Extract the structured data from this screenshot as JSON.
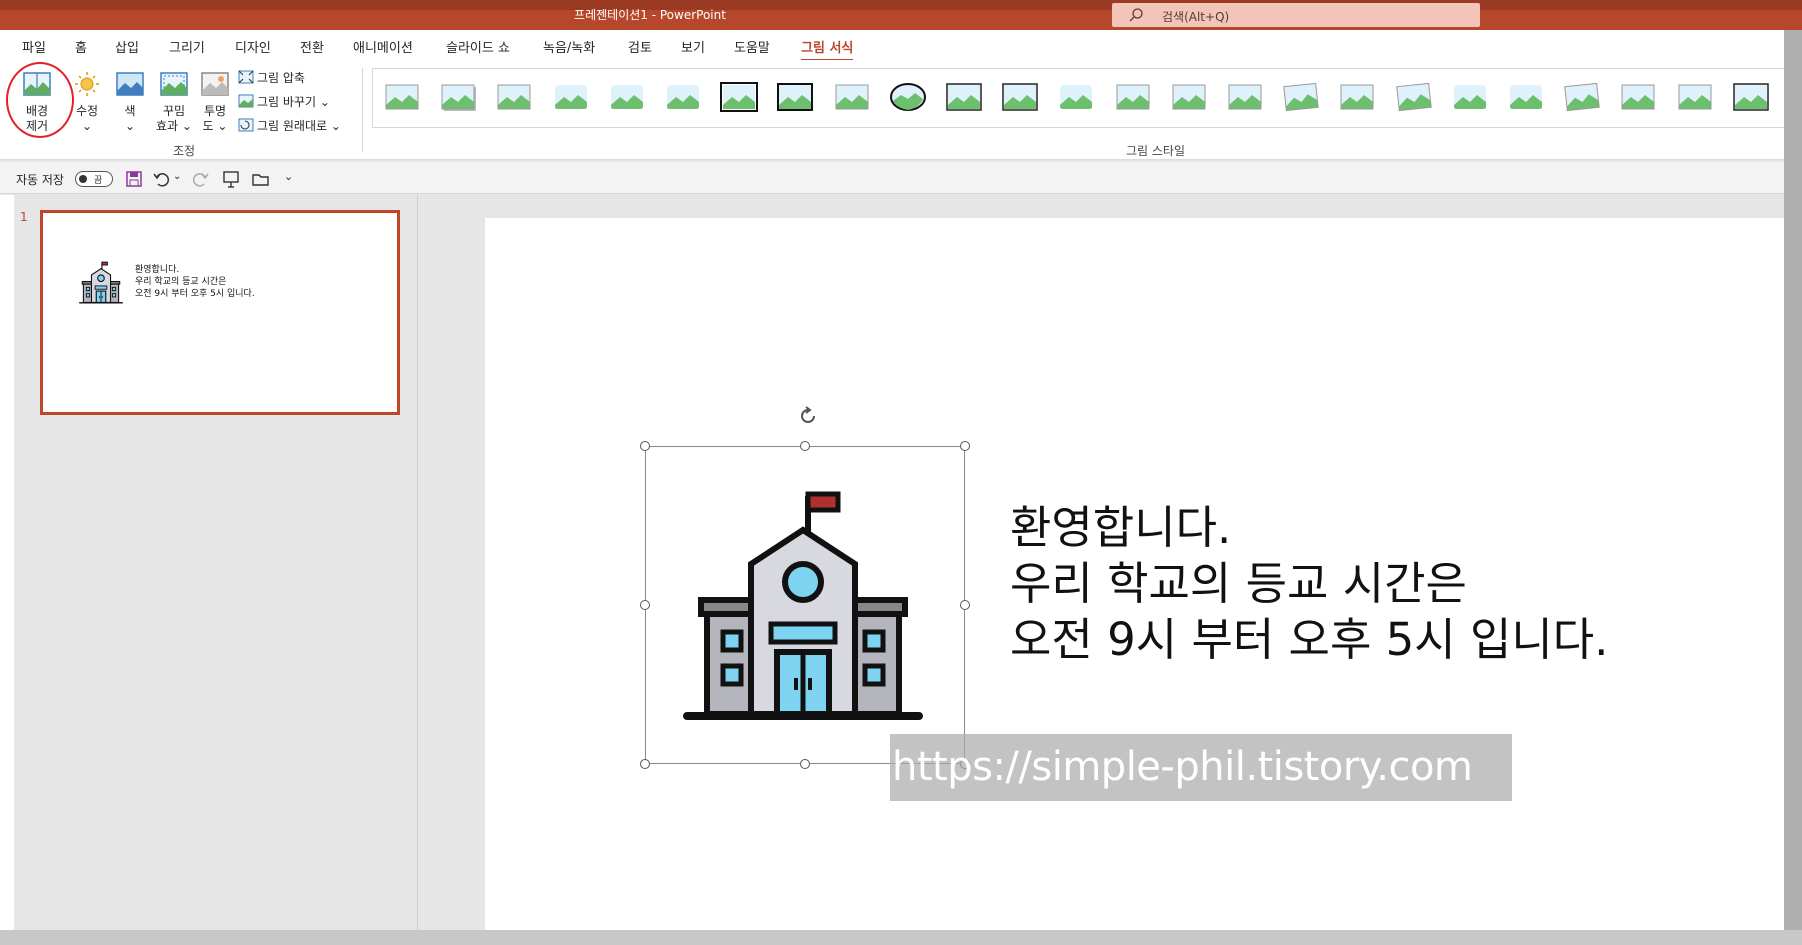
{
  "window": {
    "title": "프레젠테이션1  -  PowerPoint",
    "search_placeholder": "검색(Alt+Q)"
  },
  "tabs": [
    {
      "label": "파일"
    },
    {
      "label": "홈"
    },
    {
      "label": "삽입"
    },
    {
      "label": "그리기"
    },
    {
      "label": "디자인"
    },
    {
      "label": "전환"
    },
    {
      "label": "애니메이션"
    },
    {
      "label": "슬라이드 쇼"
    },
    {
      "label": "녹음/녹화"
    },
    {
      "label": "검토"
    },
    {
      "label": "보기"
    },
    {
      "label": "도움말"
    },
    {
      "label": "그림 서식",
      "active": true
    }
  ],
  "ribbon": {
    "remove_bg": {
      "line1": "배경",
      "line2": "제거"
    },
    "corrections": {
      "label": "수정",
      "arrow": "⌄"
    },
    "color": {
      "label": "색",
      "arrow": "⌄"
    },
    "artistic": {
      "line1": "꾸밈",
      "line2": "효과 ⌄"
    },
    "transparency": {
      "line1": "투명",
      "line2": "도 ⌄"
    },
    "compress": "그림 압축",
    "change": "그림 바꾸기 ⌄",
    "reset": "그림 원래대로  ⌄",
    "adjust_group": "조정",
    "styles_group": "그림 스타일"
  },
  "qat": {
    "autosave_label": "자동 저장",
    "toggle_state": "끔"
  },
  "thumbnail": {
    "number": "1",
    "lines": [
      "환영합니다.",
      "우리 학교의 등교 시간은",
      "오전 9시 부터 오후 5시 입니다."
    ]
  },
  "slide": {
    "lines": [
      "환영합니다.",
      "우리 학교의 등교 시간은",
      "오전 9시 부터 오후 5시 입니다."
    ],
    "watermark": "https://simple-phil.tistory.com"
  },
  "icons": {
    "school": "school-building-icon",
    "search": "search-icon",
    "save": "save-icon",
    "undo": "undo-icon",
    "redo": "redo-icon"
  },
  "colors": {
    "accent": "#b7472a",
    "annotation": "#e0232a"
  }
}
